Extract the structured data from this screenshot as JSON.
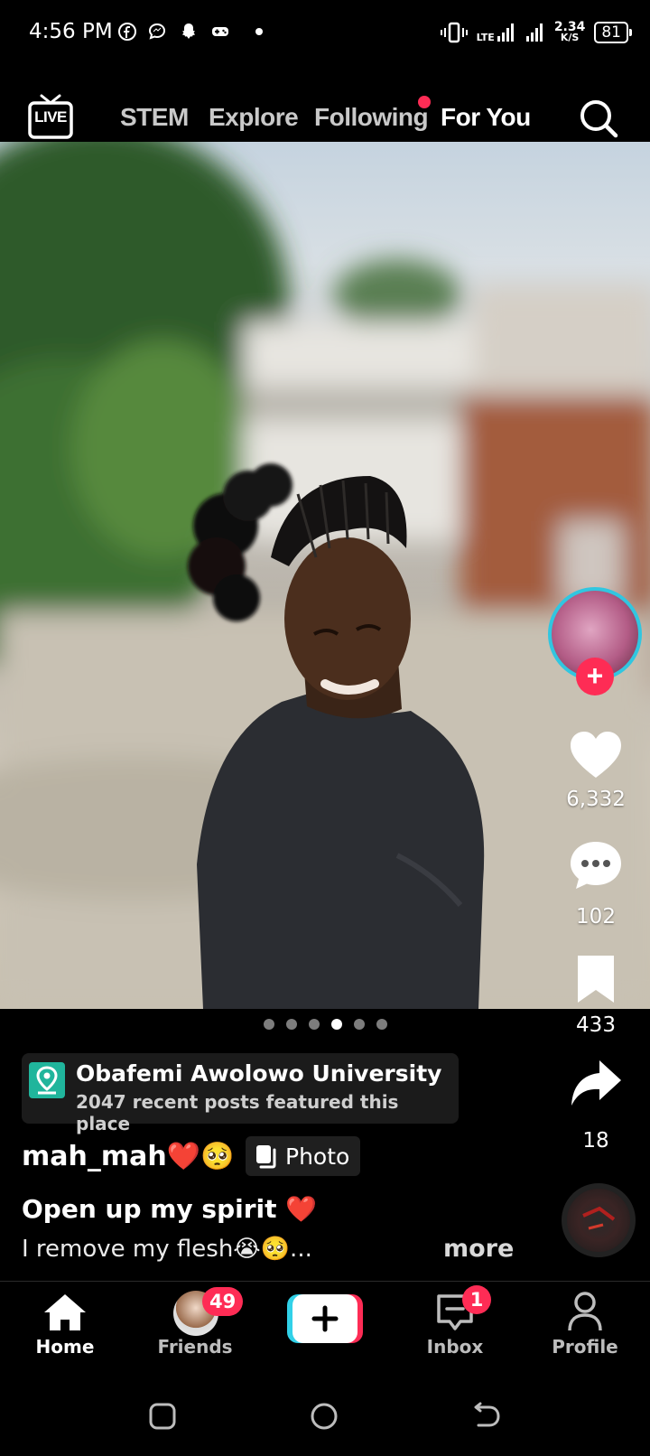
{
  "status_bar": {
    "time": "4:56 PM",
    "network_speed_value": "2.34",
    "network_speed_unit": "K/S",
    "network_type": "LTE",
    "battery": "81"
  },
  "top_nav": {
    "live_label": "LIVE",
    "tabs": [
      "STEM",
      "Explore",
      "Following",
      "For You"
    ],
    "active_tab": "For You"
  },
  "post": {
    "pager": {
      "count": 6,
      "active_index": 3
    },
    "likes": "6,332",
    "comments": "102",
    "saves": "433",
    "shares": "18",
    "place": {
      "name": "Obafemi Awolowo University",
      "subtitle": "2047 recent posts featured this place"
    },
    "username": "mah_mah",
    "username_emoji": "❤️🥺",
    "type_badge": "Photo",
    "title": "Open up my spirit",
    "title_emoji": "❤️",
    "description": "I remove my flesh😭🥺...",
    "more_label": "more"
  },
  "bottom_nav": {
    "home": "Home",
    "friends": "Friends",
    "friends_badge": "49",
    "inbox": "Inbox",
    "inbox_badge": "1",
    "profile": "Profile"
  },
  "colors": {
    "accent_red": "#fe2c55",
    "accent_cyan": "#31c6e0",
    "place_green": "#20b59c"
  }
}
